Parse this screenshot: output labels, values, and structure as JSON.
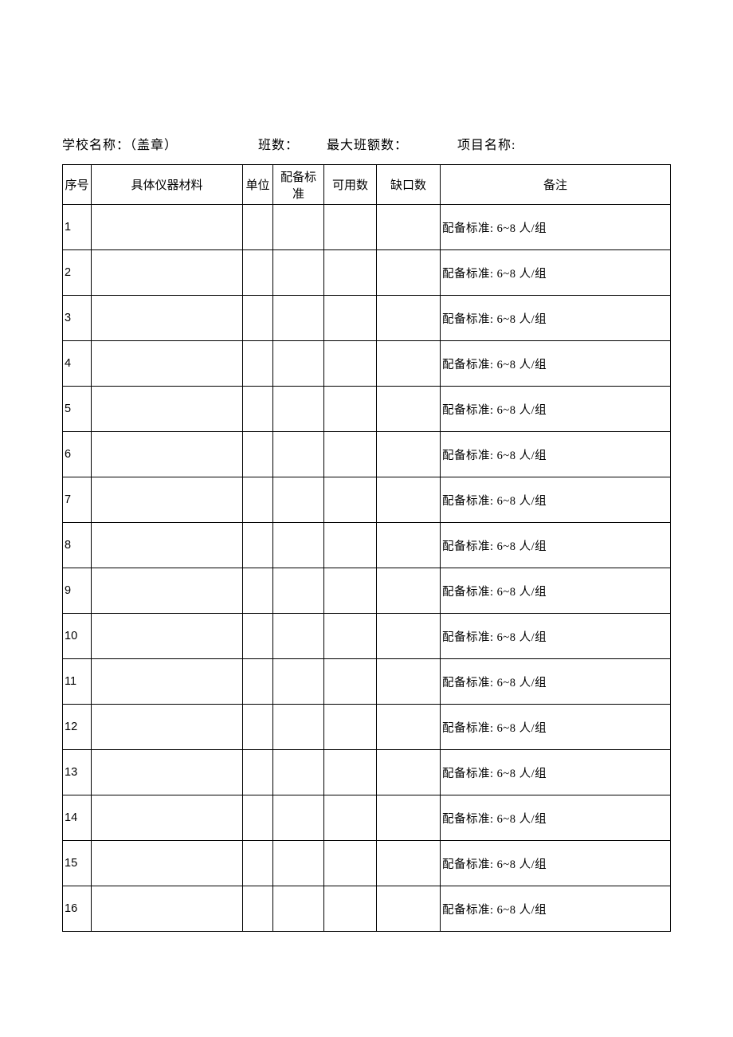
{
  "header": {
    "school_label": "学校名称：（盖章）",
    "classes_label": "班数：",
    "max_class_size_label": "最大班额数：",
    "project_label": "项目名称:"
  },
  "columns": {
    "seq": "序号",
    "item": "具体仪器材料",
    "unit": "单位",
    "standard": "配备标准",
    "available": "可用数",
    "gap": "缺口数",
    "note": "备注"
  },
  "rows": [
    {
      "seq": "1",
      "item": "",
      "unit": "",
      "standard": "",
      "available": "",
      "gap": "",
      "note": "配备标准: 6~8 人/组"
    },
    {
      "seq": "2",
      "item": "",
      "unit": "",
      "standard": "",
      "available": "",
      "gap": "",
      "note": "配备标准: 6~8 人/组"
    },
    {
      "seq": "3",
      "item": "",
      "unit": "",
      "standard": "",
      "available": "",
      "gap": "",
      "note": "配备标准: 6~8 人/组"
    },
    {
      "seq": "4",
      "item": "",
      "unit": "",
      "standard": "",
      "available": "",
      "gap": "",
      "note": "配备标准: 6~8 人/组"
    },
    {
      "seq": "5",
      "item": "",
      "unit": "",
      "standard": "",
      "available": "",
      "gap": "",
      "note": "配备标准: 6~8 人/组"
    },
    {
      "seq": "6",
      "item": "",
      "unit": "",
      "standard": "",
      "available": "",
      "gap": "",
      "note": "配备标准: 6~8 人/组"
    },
    {
      "seq": "7",
      "item": "",
      "unit": "",
      "standard": "",
      "available": "",
      "gap": "",
      "note": "配备标准: 6~8 人/组"
    },
    {
      "seq": "8",
      "item": "",
      "unit": "",
      "standard": "",
      "available": "",
      "gap": "",
      "note": "配备标准: 6~8 人/组"
    },
    {
      "seq": "9",
      "item": "",
      "unit": "",
      "standard": "",
      "available": "",
      "gap": "",
      "note": "配备标准: 6~8 人/组"
    },
    {
      "seq": "10",
      "item": "",
      "unit": "",
      "standard": "",
      "available": "",
      "gap": "",
      "note": "配备标准: 6~8 人/组"
    },
    {
      "seq": "11",
      "item": "",
      "unit": "",
      "standard": "",
      "available": "",
      "gap": "",
      "note": "配备标准: 6~8 人/组"
    },
    {
      "seq": "12",
      "item": "",
      "unit": "",
      "standard": "",
      "available": "",
      "gap": "",
      "note": "配备标准: 6~8 人/组"
    },
    {
      "seq": "13",
      "item": "",
      "unit": "",
      "standard": "",
      "available": "",
      "gap": "",
      "note": "配备标准: 6~8 人/组"
    },
    {
      "seq": "14",
      "item": "",
      "unit": "",
      "standard": "",
      "available": "",
      "gap": "",
      "note": "配备标准: 6~8 人/组"
    },
    {
      "seq": "15",
      "item": "",
      "unit": "",
      "standard": "",
      "available": "",
      "gap": "",
      "note": "配备标准: 6~8 人/组"
    },
    {
      "seq": "16",
      "item": "",
      "unit": "",
      "standard": "",
      "available": "",
      "gap": "",
      "note": "配备标准: 6~8 人/组"
    }
  ]
}
